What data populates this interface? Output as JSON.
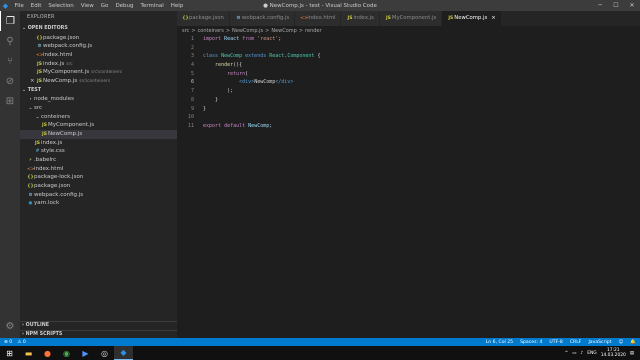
{
  "titlebar": {
    "menu": [
      "File",
      "Edit",
      "Selection",
      "View",
      "Go",
      "Debug",
      "Terminal",
      "Help"
    ],
    "title": "● NewComp.js - test - Visual Studio Code"
  },
  "sidebar": {
    "title": "EXPLORER",
    "open_editors": {
      "header": "OPEN EDITORS",
      "items": [
        {
          "icon": "{}",
          "color": "#cbcb41",
          "name": "package.json",
          "desc": ""
        },
        {
          "icon": "⚙",
          "color": "#8ed6fb",
          "name": "webpack.config.js",
          "desc": ""
        },
        {
          "icon": "<>",
          "color": "#e37933",
          "name": "index.html",
          "desc": ""
        },
        {
          "icon": "JS",
          "color": "#cbcb41",
          "name": "index.js",
          "desc": "src"
        },
        {
          "icon": "JS",
          "color": "#cbcb41",
          "name": "MyComponent.js",
          "desc": "src\\conteiners"
        },
        {
          "icon": "JS",
          "color": "#cbcb41",
          "name": "NewComp.js",
          "desc": "src\\conteiners"
        }
      ]
    },
    "project": {
      "header": "TEST",
      "items": [
        {
          "name": "node_modules",
          "indent": 1,
          "type": "folder-closed"
        },
        {
          "name": "src",
          "indent": 1,
          "type": "folder-open"
        },
        {
          "name": "conteiners",
          "indent": 2,
          "type": "folder-open"
        },
        {
          "name": "MyComponent.js",
          "indent": 3,
          "type": "js"
        },
        {
          "name": "NewComp.js",
          "indent": 3,
          "type": "js"
        },
        {
          "name": "index.js",
          "indent": 2,
          "type": "js"
        },
        {
          "name": "style.css",
          "indent": 2,
          "type": "css"
        },
        {
          "name": ".babelrc",
          "indent": 1,
          "type": "babel"
        },
        {
          "name": "index.html",
          "indent": 1,
          "type": "html"
        },
        {
          "name": "package-lock.json",
          "indent": 1,
          "type": "json"
        },
        {
          "name": "package.json",
          "indent": 1,
          "type": "json"
        },
        {
          "name": "webpack.config.js",
          "indent": 1,
          "type": "webpack"
        },
        {
          "name": "yarn.lock",
          "indent": 1,
          "type": "yarn"
        }
      ]
    },
    "outline": "OUTLINE",
    "npm_scripts": "NPM SCRIPTS"
  },
  "tabs": [
    {
      "icon": "{}",
      "color": "#cbcb41",
      "label": "package.json"
    },
    {
      "icon": "⚙",
      "color": "#8ed6fb",
      "label": "webpack.config.js"
    },
    {
      "icon": "<>",
      "color": "#e37933",
      "label": "index.html"
    },
    {
      "icon": "JS",
      "color": "#cbcb41",
      "label": "index.js"
    },
    {
      "icon": "JS",
      "color": "#cbcb41",
      "label": "MyComponent.js"
    },
    {
      "icon": "JS",
      "color": "#cbcb41",
      "label": "NewComp.js"
    }
  ],
  "breadcrumb": [
    "src",
    ">",
    "conteiners",
    ">",
    "NewComp.js",
    ">",
    "NewComp",
    ">",
    "render"
  ],
  "editor": {
    "lines": [
      [
        [
          "kw2",
          "import "
        ],
        [
          "var",
          "React "
        ],
        [
          "kw2",
          "from "
        ],
        [
          "str",
          "'react'"
        ],
        [
          "code",
          ";"
        ]
      ],
      [],
      [
        [
          "kw",
          "class "
        ],
        [
          "cls",
          "NewComp "
        ],
        [
          "kw",
          "extends "
        ],
        [
          "cls",
          "React"
        ],
        [
          "code",
          "."
        ],
        [
          "cls",
          "Component "
        ],
        [
          "code",
          "{"
        ]
      ],
      [
        [
          "code",
          "    "
        ],
        [
          "fn",
          "render"
        ],
        [
          "code",
          "(){"
        ]
      ],
      [
        [
          "code",
          "        "
        ],
        [
          "kw2",
          "return"
        ],
        [
          "code",
          "("
        ]
      ],
      [
        [
          "code",
          "            "
        ],
        [
          "tag",
          "<div>"
        ],
        [
          "code",
          "NewComp"
        ],
        [
          "tag",
          "</div>"
        ]
      ],
      [
        [
          "code",
          "        );"
        ]
      ],
      [
        [
          "code",
          "    }"
        ]
      ],
      [
        [
          "code",
          "}"
        ]
      ],
      [],
      [
        [
          "kw2",
          "export "
        ],
        [
          "kw2",
          "default "
        ],
        [
          "var",
          "NewComp"
        ],
        [
          "code",
          ";"
        ]
      ]
    ],
    "current_line": 6
  },
  "statusbar": {
    "left": [
      "⊗ 0",
      "⚠ 0"
    ],
    "right": [
      "Ln 6, Col 25",
      "Spaces: 4",
      "UTF-8",
      "CRLF",
      "JavaScript",
      "☺",
      "🔔"
    ]
  },
  "taskbar": {
    "apps": [
      "windows-start",
      "file-explorer",
      "firefox",
      "chrome",
      "powershell",
      "obs",
      "vscode"
    ],
    "tray": [
      "^",
      "ENG"
    ],
    "time": "17:21",
    "date": "14.03.2020"
  }
}
